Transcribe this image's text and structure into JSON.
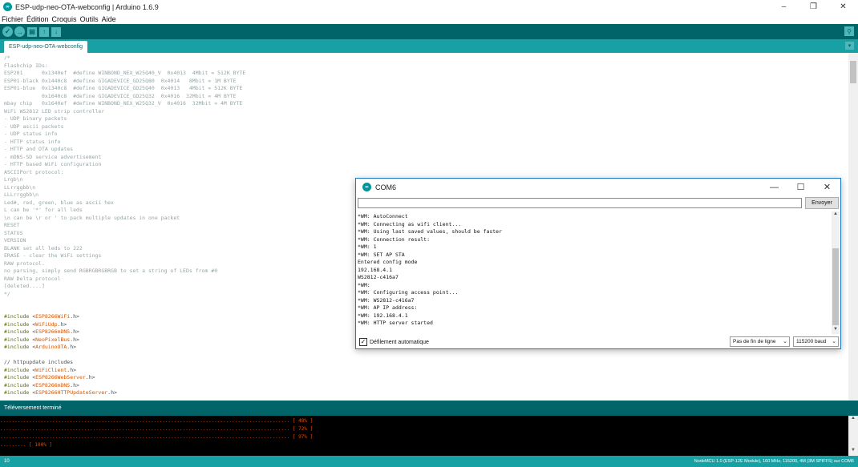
{
  "window": {
    "title": "ESP-udp-neo-OTA-webconfig | Arduino 1.6.9",
    "minimize": "–",
    "maximize": "❐",
    "close": "✕",
    "app_icon": "∞"
  },
  "menu": [
    "Fichier",
    "Édition",
    "Croquis",
    "Outils",
    "Aide"
  ],
  "toolbar": {
    "verify": "✓",
    "upload": "→",
    "new": "▤",
    "open": "↑",
    "save": "↓",
    "serial": "⚲"
  },
  "tab": {
    "label": "ESP-udp-neo-OTA-webconfig",
    "menu": "▾"
  },
  "code": [
    [
      {
        "t": "/*",
        "c": "cm"
      }
    ],
    [
      {
        "t": "Flashchip IDs:",
        "c": "cm"
      }
    ],
    [
      {
        "t": "ESP201      0x1340ef  #define WINBOND_NEX_W25Q40_V  0x4013  4Mbit = 512K BYTE",
        "c": "cm"
      }
    ],
    [
      {
        "t": "ESP01-black 0x1440c8  #define GIGADEVICE_GD25Q80  0x4014   8Mbit = 1M BYTE",
        "c": "cm"
      }
    ],
    [
      {
        "t": "ESP01-blue  0x1340c8  #define GIGADEVICE_GD25Q40  0x4013   4Mbit = 512K BYTE",
        "c": "cm"
      }
    ],
    [
      {
        "t": "            0x1640c8  #define GIGADEVICE_GD25Q32  0x4016  32Mbit = 4M BYTE",
        "c": "cm"
      }
    ],
    [
      {
        "t": "mbay chip   0x1640ef  #define WINBOND_NEX_W25Q32_V  0x4016  32Mbit = 4M BYTE",
        "c": "cm"
      }
    ],
    [
      {
        "t": "WiFi WS2812 LED strip controller",
        "c": "cm"
      }
    ],
    [
      {
        "t": "- UDP binary packets",
        "c": "cm"
      }
    ],
    [
      {
        "t": "- UDP ascii packets",
        "c": "cm"
      }
    ],
    [
      {
        "t": "- UDP status info",
        "c": "cm"
      }
    ],
    [
      {
        "t": "- HTTP status info",
        "c": "cm"
      }
    ],
    [
      {
        "t": "- HTTP and OTA updates",
        "c": "cm"
      }
    ],
    [
      {
        "t": "- mDNS-SD service advertisement",
        "c": "cm"
      }
    ],
    [
      {
        "t": "- HTTP based WiFi configuration",
        "c": "cm"
      }
    ],
    [
      {
        "t": "ASCIIPort protocol:",
        "c": "cm"
      }
    ],
    [
      {
        "t": "Lrgb\\n",
        "c": "cm"
      }
    ],
    [
      {
        "t": "LLrrggbb\\n",
        "c": "cm"
      }
    ],
    [
      {
        "t": "LLLrrggbb\\n",
        "c": "cm"
      }
    ],
    [
      {
        "t": "Led#, red, green, blue as ascii hex",
        "c": "cm"
      }
    ],
    [
      {
        "t": "L can be '*' for all leds",
        "c": "cm"
      }
    ],
    [
      {
        "t": "\\n can be \\r or ' to pack multiple updates in one packet",
        "c": "cm"
      }
    ],
    [
      {
        "t": "RESET",
        "c": "cm"
      }
    ],
    [
      {
        "t": "STATUS",
        "c": "cm"
      }
    ],
    [
      {
        "t": "VERSION",
        "c": "cm"
      }
    ],
    [
      {
        "t": "BLANK set all leds to 222",
        "c": "cm"
      }
    ],
    [
      {
        "t": "ERASE - clear the WiFi settings",
        "c": "cm"
      }
    ],
    [
      {
        "t": "RAW protocol.",
        "c": "cm"
      }
    ],
    [
      {
        "t": "no parsing, simply send RGBRGBRGBRGB to set a string of LEDs from #0",
        "c": "cm"
      }
    ],
    [
      {
        "t": "RAW Delta protocol",
        "c": "cm"
      }
    ],
    [
      {
        "t": "[deleted....]",
        "c": "cm"
      }
    ],
    [
      {
        "t": "*/",
        "c": "cm"
      }
    ],
    [],
    [],
    [
      {
        "t": "#include ",
        "c": "kw"
      },
      {
        "t": "<",
        "c": "plain"
      },
      {
        "t": "ESP8266WiFi",
        "c": "str"
      },
      {
        "t": ".h>",
        "c": "plain"
      }
    ],
    [
      {
        "t": "#include ",
        "c": "kw"
      },
      {
        "t": "<",
        "c": "plain"
      },
      {
        "t": "WiFiUdp",
        "c": "str"
      },
      {
        "t": ".h>",
        "c": "plain"
      }
    ],
    [
      {
        "t": "#include ",
        "c": "kw"
      },
      {
        "t": "<",
        "c": "plain"
      },
      {
        "t": "ESP8266mDNS",
        "c": "str"
      },
      {
        "t": ".h>",
        "c": "plain"
      }
    ],
    [
      {
        "t": "#include ",
        "c": "kw"
      },
      {
        "t": "<",
        "c": "plain"
      },
      {
        "t": "NeoPixelBus",
        "c": "str"
      },
      {
        "t": ".h>",
        "c": "plain"
      }
    ],
    [
      {
        "t": "#include ",
        "c": "kw"
      },
      {
        "t": "<",
        "c": "plain"
      },
      {
        "t": "ArduinoOTA",
        "c": "str"
      },
      {
        "t": ".h>",
        "c": "plain"
      }
    ],
    [],
    [
      {
        "t": "// httpupdate includes",
        "c": "plain"
      }
    ],
    [
      {
        "t": "#include ",
        "c": "kw"
      },
      {
        "t": "<",
        "c": "plain"
      },
      {
        "t": "WiFiClient",
        "c": "str"
      },
      {
        "t": ".h>",
        "c": "plain"
      }
    ],
    [
      {
        "t": "#include ",
        "c": "kw"
      },
      {
        "t": "<",
        "c": "plain"
      },
      {
        "t": "ESP8266WebServer",
        "c": "str"
      },
      {
        "t": ".h>",
        "c": "plain"
      }
    ],
    [
      {
        "t": "#include ",
        "c": "kw"
      },
      {
        "t": "<",
        "c": "plain"
      },
      {
        "t": "ESP8266mDNS",
        "c": "str"
      },
      {
        "t": ".h>",
        "c": "plain"
      }
    ],
    [
      {
        "t": "#include ",
        "c": "kw"
      },
      {
        "t": "<",
        "c": "plain"
      },
      {
        "t": "ESP8266HTTPUpdateServer",
        "c": "str"
      },
      {
        "t": ".h>",
        "c": "plain"
      }
    ]
  ],
  "status": {
    "text": "Téléversement terminé"
  },
  "console": [
    {
      "dots": "....................................................................................................",
      "pct": "[ 48% ]"
    },
    {
      "dots": "....................................................................................................",
      "pct": "[ 72% ]"
    },
    {
      "dots": "....................................................................................................",
      "pct": "[ 97% ]"
    },
    {
      "dots": ".........",
      "pct": "[ 100% ]"
    }
  ],
  "console_scroll": {
    "up": "▲",
    "down": "▼"
  },
  "bottom": {
    "line_number": "10",
    "board_info": "NodeMCU 1.0 (ESP-12E Module), 160 MHz, 115200, 4M (3M SPIFFS) sur COM6"
  },
  "serial_monitor": {
    "title": "COM6",
    "icon": "∞",
    "minimize": "—",
    "maximize": "☐",
    "close": "✕",
    "input_value": "",
    "send_label": "Envoyer",
    "output": [
      "*WM: AutoConnect",
      "*WM: Connecting as wifi client...",
      "*WM: Using last saved values, should be faster",
      "*WM: Connection result:",
      "*WM: 1",
      "*WM: SET AP STA",
      "Entered config mode",
      "192.168.4.1",
      "WS2812-c416a7",
      "*WM:",
      "*WM: Configuring access point...",
      "*WM: WS2812-c416a7",
      "*WM: AP IP address:",
      "*WM: 192.168.4.1",
      "*WM: HTTP server started"
    ],
    "scroll_up": "▲",
    "scroll_down": "▼",
    "autoscroll_checked": "✓",
    "autoscroll_label": "Défilement automatique",
    "line_ending": "Pas de fin de ligne",
    "baud": "115200 baud",
    "dropdown_arrow": "⌄"
  },
  "colors": {
    "toolbar": "#006468",
    "tabbar": "#17a1a5",
    "comment": "#95a5a6",
    "keyword": "#5e6d03",
    "string": "#d35400",
    "console_text": "#e34c00"
  }
}
